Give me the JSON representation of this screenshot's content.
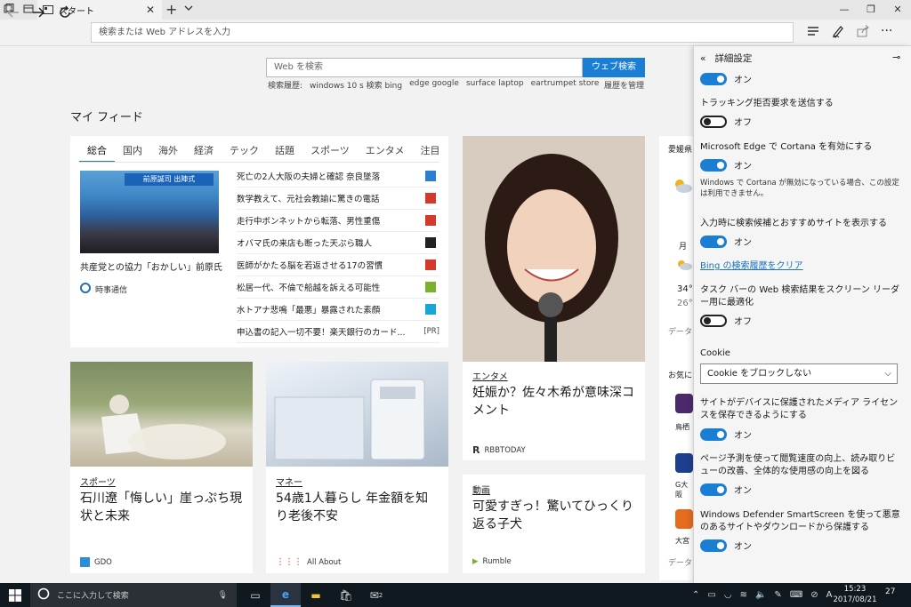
{
  "tab": {
    "title": "スタート"
  },
  "address": {
    "placeholder": "検索または Web アドレスを入力"
  },
  "search": {
    "placeholder": "Web を検索",
    "button": "ウェブ検索"
  },
  "history": {
    "label": "検索履歴:",
    "items": [
      "windows 10 s 検索 bing",
      "edge google",
      "surface laptop",
      "eartrumpet store"
    ],
    "manage": "履歴を管理"
  },
  "feed": {
    "title": "マイ フィード",
    "tabs": [
      "総合",
      "国内",
      "海外",
      "経済",
      "テック",
      "話題",
      "スポーツ",
      "エンタメ",
      "注目"
    ],
    "top": {
      "image_banner": "前原誠司 出陣式",
      "caption": "共産党との協力「おかしい」前原氏",
      "source": "時事通信"
    },
    "headlines": [
      {
        "text": "死亡の2人大阪の夫婦と確認 奈良墜落",
        "color": "#2a7fd0"
      },
      {
        "text": "数学教えて、元社会教諭に驚きの電話",
        "color": "#d23b2c"
      },
      {
        "text": "走行中ボンネットから転落、男性重傷",
        "color": "#d23b2c"
      },
      {
        "text": "オバマ氏の来店も断った天ぷら職人",
        "color": "#222222"
      },
      {
        "text": "医師がかたる脳を若返させる17の習慣",
        "color": "#d23b2c"
      },
      {
        "text": "松居一代、不倫で船越を訴える可能性",
        "color": "#7ab02e"
      },
      {
        "text": "水トアナ悲鳴「最悪」暴露された素顔",
        "color": "#18a6d8"
      },
      {
        "text": "申込書の記入一切不要！楽天銀行のカード...",
        "color": "#ffffff",
        "badge": "[PR]"
      }
    ],
    "golf": {
      "category": "スポーツ",
      "title": "石川遼「悔しい」崖っぷち現状と未来",
      "source": "GDO"
    },
    "money": {
      "category": "マネー",
      "title": "54歳1人暮らし 年金額を知り老後不安",
      "source": "All About"
    },
    "ent": {
      "category": "エンタメ",
      "title": "妊娠か？佐々木希が意味深コメント",
      "source": "RBBTODAY"
    },
    "video": {
      "category": "動画",
      "title": "可愛すぎっ！驚いてひっくり返る子犬",
      "source": "Rumble"
    },
    "strip": [
      "愛媛県",
      "月",
      "34°",
      "26°",
      "データ",
      "お気に",
      "鳥栖",
      "G大阪",
      "大宮",
      "データ"
    ]
  },
  "settings": {
    "header": "詳細設定",
    "on": "オン",
    "off": "オフ",
    "dnt": "トラッキング拒否要求を送信する",
    "cortana": "Microsoft Edge で Cortana を有効にする",
    "cortana_note": "Windows で Cortana が無効になっている場合、この設定は利用できません。",
    "suggest": "入力時に検索候補とおすすめサイトを表示する",
    "clear_history": "Bing の検索履歴をクリア",
    "taskbar_reader": "タスク バーの Web 検索結果をスクリーン リーダー用に最適化",
    "cookie_label": "Cookie",
    "cookie_value": "Cookie をブロックしない",
    "media_license": "サイトがデバイスに保護されたメディア ライセンスを保存できるようにする",
    "page_predict": "ページ予測を使って閲覧速度の向上、読み取りビューの改善、全体的な使用感の向上を図る",
    "smartscreen": "Windows Defender SmartScreen を使って悪意のあるサイトやダウンロードから保護する"
  },
  "taskbar": {
    "search_placeholder": "ここに入力して検索",
    "time": "15:23",
    "date": "2017/08/21",
    "notifications": "27",
    "mail_badge": "2"
  }
}
